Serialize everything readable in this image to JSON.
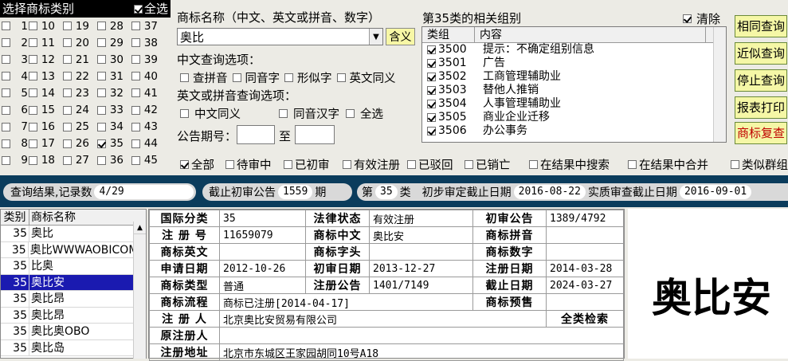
{
  "class_panel": {
    "title": "选择商标类别",
    "all_label": "全选",
    "all_checked": true,
    "columns": [
      [
        1,
        2,
        3,
        4,
        5,
        6,
        7,
        8,
        9
      ],
      [
        10,
        11,
        12,
        13,
        14,
        15,
        16,
        17,
        18
      ],
      [
        19,
        20,
        21,
        22,
        23,
        24,
        25,
        26,
        27
      ],
      [
        28,
        29,
        30,
        31,
        32,
        33,
        34,
        35,
        36
      ],
      [
        37,
        38,
        39,
        40,
        41,
        42,
        43,
        44,
        45
      ]
    ],
    "checked": [
      35
    ]
  },
  "name_section": {
    "label": "商标名称（中文、英文或拼音、数字）",
    "value": "奥比",
    "meaning_button": "含义",
    "cn_options_label": "中文查询选项：",
    "cn_options": [
      "查拼音",
      "同音字",
      "形似字",
      "英文同义"
    ],
    "en_options_label": "英文或拼音查询选项：",
    "en_options": [
      "中文同义",
      "同音汉字",
      "全选"
    ],
    "gazette_label": "公告期号：",
    "gazette_to": "至"
  },
  "group_section": {
    "title": "第35类的相关组别",
    "clear_label": "清除",
    "clear_checked": true,
    "col_group": "类组",
    "col_content": "内容",
    "rows": [
      {
        "code": "3500",
        "text": "提示：不确定组别信息"
      },
      {
        "code": "3501",
        "text": "广告"
      },
      {
        "code": "3502",
        "text": "工商管理辅助业"
      },
      {
        "code": "3503",
        "text": "替他人推销"
      },
      {
        "code": "3504",
        "text": "人事管理辅助业"
      },
      {
        "code": "3505",
        "text": "商业企业迁移"
      },
      {
        "code": "3506",
        "text": "办公事务"
      }
    ]
  },
  "buttons": {
    "same_query": "相同查询",
    "similar_query": "近似查询",
    "stop_query": "停止查询",
    "report_print": "报表打印",
    "recheck": "商标复查"
  },
  "filters": {
    "items": [
      {
        "label": "全部",
        "checked": true
      },
      {
        "label": "待审中",
        "checked": false
      },
      {
        "label": "已初审",
        "checked": false
      },
      {
        "label": "有效注册",
        "checked": false
      },
      {
        "label": "已驳回",
        "checked": false
      },
      {
        "label": "已销亡",
        "checked": false
      },
      {
        "label": "在结果中搜索",
        "checked": false
      },
      {
        "label": "在结果中合并",
        "checked": false
      },
      {
        "label": "类似群组",
        "checked": false
      }
    ]
  },
  "status": {
    "result_label": "查询结果,记录数",
    "result_count": "4/29",
    "deadline_label": "截止初审公告",
    "deadline_value": "1559",
    "deadline_unit": "期",
    "class_prefix": "第",
    "class_value": "35",
    "class_suffix": "类",
    "prelim_label": "初步审定截止日期",
    "prelim_date": "2016-08-22",
    "subst_label": "实质审查截止日期",
    "subst_date": "2016-09-01"
  },
  "result_list": {
    "col_class": "类别",
    "col_name": "商标名称",
    "rows": [
      {
        "cls": "35",
        "name": "奥比"
      },
      {
        "cls": "35",
        "name": "奥比WWWAOBICOM"
      },
      {
        "cls": "35",
        "name": "比奥"
      },
      {
        "cls": "35",
        "name": "奥比安",
        "selected": true
      },
      {
        "cls": "35",
        "name": "奥比昂"
      },
      {
        "cls": "35",
        "name": "奥比昂"
      },
      {
        "cls": "35",
        "name": "奥比奥OBO"
      },
      {
        "cls": "35",
        "name": "奥比岛"
      }
    ]
  },
  "detail": {
    "k_intl": "国际分类",
    "v_intl": "35",
    "k_legal": "法律状态",
    "v_legal": "有效注册",
    "k_prelim_pub": "初审公告",
    "v_prelim_pub": "1389/4792",
    "k_regno": "注 册 号",
    "v_regno": "11659079",
    "k_cn": "商标中文",
    "v_cn": "奥比安",
    "k_pinyin": "商标拼音",
    "v_pinyin": "",
    "k_en": "商标英文",
    "v_en": "",
    "k_head": "商标字头",
    "v_head": "",
    "k_num": "商标数字",
    "v_num": "",
    "k_apply": "申请日期",
    "v_apply": "2012-10-26",
    "k_prelim_date": "初审日期",
    "v_prelim_date": "2013-12-27",
    "k_reg_date": "注册日期",
    "v_reg_date": "2014-03-28",
    "k_type": "商标类型",
    "v_type": "普通",
    "k_reg_pub": "注册公告",
    "v_reg_pub": "1401/7149",
    "k_expire": "截止日期",
    "v_expire": "2024-03-27",
    "k_flow": "商标流程",
    "v_flow": "商标已注册[2014-04-17]",
    "k_presale": "商标预售",
    "v_presale": "",
    "k_owner": "注 册 人",
    "v_owner": "北京奥比安贸易有限公司",
    "all_search": "全类检索",
    "k_orig_owner": "原注册人",
    "v_orig_owner": "",
    "k_address": "注册地址",
    "v_address": "北京市东城区王家园胡同10号A18"
  },
  "preview": {
    "text": "奥比安"
  }
}
